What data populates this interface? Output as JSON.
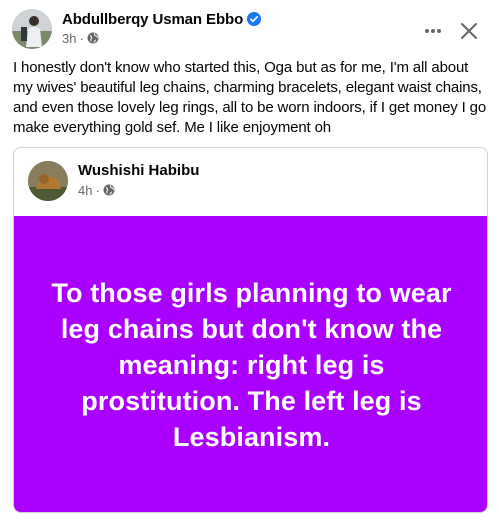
{
  "post": {
    "author": "Abdullberqy Usman Ebbo",
    "time": "3h",
    "separator": "·",
    "text": "I honestly don't know who started this, Oga but as for me, I'm all about my wives' beautiful leg chains, charming bracelets, elegant waist chains, and even those lovely leg rings, all to be worn indoors, if I get money I go make everything gold sef. Me I like enjoyment oh",
    "icons": {
      "verified": "verified-badge-icon",
      "audience": "globe-icon",
      "more": "more-options-icon",
      "close": "close-icon"
    },
    "colors": {
      "verified": "#1877f2",
      "meta_text": "#65676b"
    }
  },
  "shared": {
    "author": "Wushishi Habibu",
    "time": "4h",
    "separator": "·",
    "background_color": "#aa00ff",
    "text": "To those girls planning to wear leg chains but don't know the meaning: right leg is prostitution. The left leg is Lesbianism.",
    "text_color": "#ffffff"
  }
}
